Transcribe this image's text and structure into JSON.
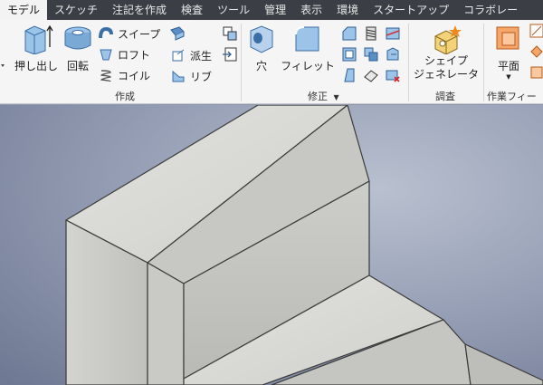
{
  "tabs": [
    {
      "label": "モデル",
      "active": true
    },
    {
      "label": "スケッチ"
    },
    {
      "label": "注記を作成"
    },
    {
      "label": "検査"
    },
    {
      "label": "ツール"
    },
    {
      "label": "管理"
    },
    {
      "label": "表示"
    },
    {
      "label": "環境"
    },
    {
      "label": "スタートアップ"
    },
    {
      "label": "コラボレー"
    }
  ],
  "create_panel": {
    "title": "作成",
    "extrude": "押し出し",
    "revolve": "回転",
    "sweep": "スイープ",
    "loft": "ロフト",
    "coil": "コイル",
    "derive": "派生",
    "rib": "リブ"
  },
  "modify_panel": {
    "title": "修正",
    "hole": "穴",
    "fillet": "フィレット"
  },
  "explore_panel": {
    "title": "調査",
    "shape_generator_line1": "シェイプ",
    "shape_generator_line2": "ジェネレータ"
  },
  "work_features_panel": {
    "title": "作業フィー",
    "plane": "平面"
  },
  "colors": {
    "tab_bar": "#3b3f45",
    "ribbon": "#f5f5f5",
    "viewport_bg": "#8d97ad",
    "model_gray": "#d3d3d0"
  }
}
